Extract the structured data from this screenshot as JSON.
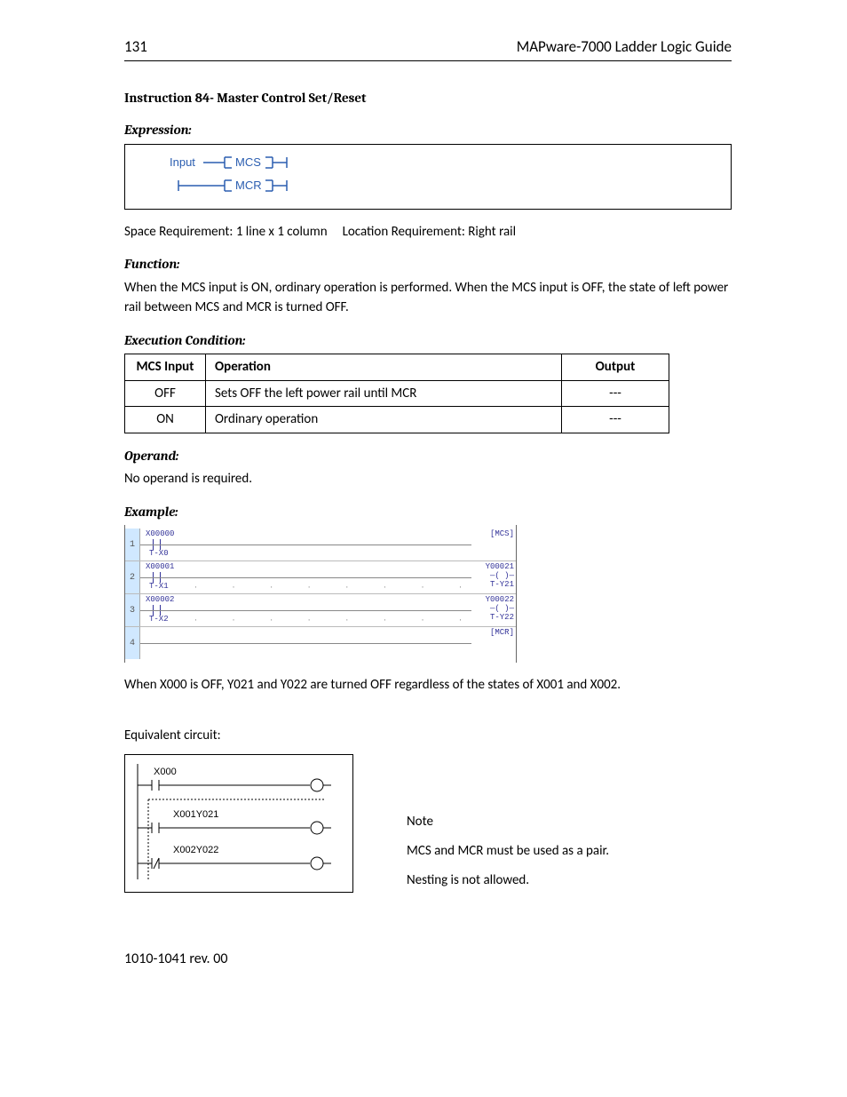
{
  "header": {
    "page_number": "131",
    "doc_title": "MAPware-7000 Ladder Logic Guide"
  },
  "title": "Instruction 84- Master Control Set/Reset",
  "expression": {
    "heading": "Expression:",
    "input_label": "Input",
    "mcs": "MCS",
    "mcr": "MCR"
  },
  "space_req": "Space Requirement: 1 line x 1 column     Location Requirement: Right rail",
  "function": {
    "heading": "Function:",
    "text": "When the MCS input is ON, ordinary operation is performed. When the MCS input is OFF, the state of left power rail between MCS and MCR is turned OFF."
  },
  "exec": {
    "heading": "Execution Condition:",
    "headers": {
      "mcs": "MCS Input",
      "op": "Operation",
      "out": "Output"
    },
    "rows": [
      {
        "mcs": "OFF",
        "op": "Sets OFF the left power rail until MCR",
        "out": "---"
      },
      {
        "mcs": "ON",
        "op": "Ordinary operation",
        "out": "---"
      }
    ]
  },
  "operand": {
    "heading": "Operand:",
    "text": "No operand is required."
  },
  "example": {
    "heading": "Example:",
    "rungs": [
      {
        "n": "1",
        "top": "X00000",
        "sub": "T-X0",
        "right_top": "",
        "right_box": "[MCS]"
      },
      {
        "n": "2",
        "top": "X00001",
        "sub": "T-X1",
        "right_top": "Y00021",
        "right_box": "T-Y21"
      },
      {
        "n": "3",
        "top": "X00002",
        "sub": "T-X2",
        "right_top": "Y00022",
        "right_box": "T-Y22"
      },
      {
        "n": "4",
        "top": "",
        "sub": "",
        "right_top": "",
        "right_box": "[MCR]"
      }
    ],
    "desc": "When X000 is OFF, Y021 and Y022 are turned OFF regardless of the states of X001 and X002."
  },
  "equiv": {
    "heading": "Equivalent circuit:",
    "labels": {
      "x000": "X000",
      "x001y021": "X001Y021",
      "x002y022": "X002Y022"
    }
  },
  "notes": {
    "note": "Note",
    "line1": "MCS and MCR must be used as a pair.",
    "line2": "Nesting is not allowed."
  },
  "footer": "1010-1041 rev. 00"
}
